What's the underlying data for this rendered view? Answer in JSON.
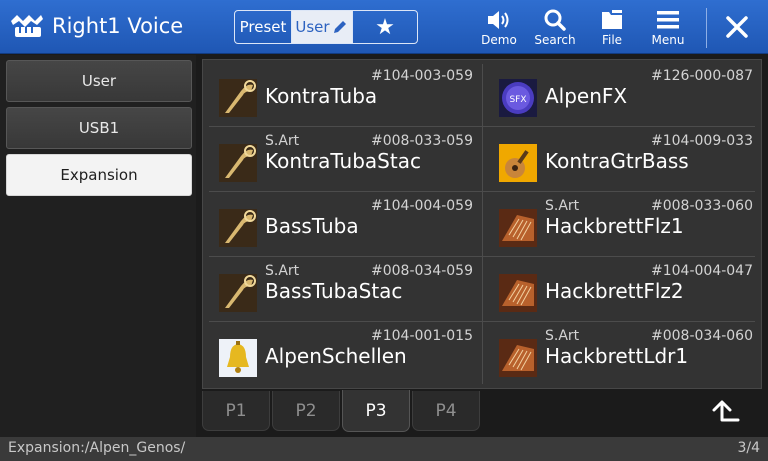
{
  "header": {
    "title": "Right1 Voice",
    "segment": {
      "preset": "Preset",
      "user": "User",
      "favorite_icon": "star-icon"
    },
    "tools": [
      {
        "label": "Demo",
        "icon": "speaker-icon"
      },
      {
        "label": "Search",
        "icon": "search-icon"
      },
      {
        "label": "File",
        "icon": "file-icon"
      },
      {
        "label": "Menu",
        "icon": "menu-icon"
      }
    ],
    "close_icon": "close-icon"
  },
  "sidebar": {
    "items": [
      {
        "label": "User",
        "selected": false
      },
      {
        "label": "USB1",
        "selected": false
      },
      {
        "label": "Expansion",
        "selected": true
      }
    ]
  },
  "voices": [
    {
      "num": "#104-003-059",
      "sart": "",
      "name": "KontraTuba",
      "icon": "tuba-icon"
    },
    {
      "num": "#126-000-087",
      "sart": "",
      "name": "AlpenFX",
      "icon": "sfx-icon"
    },
    {
      "num": "#008-033-059",
      "sart": "S.Art",
      "name": "KontraTubaStac",
      "icon": "tuba-icon"
    },
    {
      "num": "#104-009-033",
      "sart": "",
      "name": "KontraGtrBass",
      "icon": "guitar-icon"
    },
    {
      "num": "#104-004-059",
      "sart": "",
      "name": "BassTuba",
      "icon": "tuba-icon"
    },
    {
      "num": "#008-033-060",
      "sart": "S.Art",
      "name": "HackbrettFlz1",
      "icon": "hackbrett-icon"
    },
    {
      "num": "#008-034-059",
      "sart": "S.Art",
      "name": "BassTubaStac",
      "icon": "tuba-icon"
    },
    {
      "num": "#104-004-047",
      "sart": "",
      "name": "HackbrettFlz2",
      "icon": "hackbrett-icon"
    },
    {
      "num": "#104-001-015",
      "sart": "",
      "name": "AlpenSchellen",
      "icon": "bell-icon"
    },
    {
      "num": "#008-034-060",
      "sart": "S.Art",
      "name": "HackbrettLdr1",
      "icon": "hackbrett-icon"
    }
  ],
  "tabs": [
    {
      "label": "P1",
      "active": false
    },
    {
      "label": "P2",
      "active": false
    },
    {
      "label": "P3",
      "active": true
    },
    {
      "label": "P4",
      "active": false
    }
  ],
  "up_icon": "up-folder-icon",
  "status": {
    "path": "Expansion:/Alpen_Genos/",
    "page": "3/4"
  },
  "colors": {
    "header": "#2563c4",
    "selected_button": "#f3f3f3",
    "background": "#1b1b1b"
  }
}
